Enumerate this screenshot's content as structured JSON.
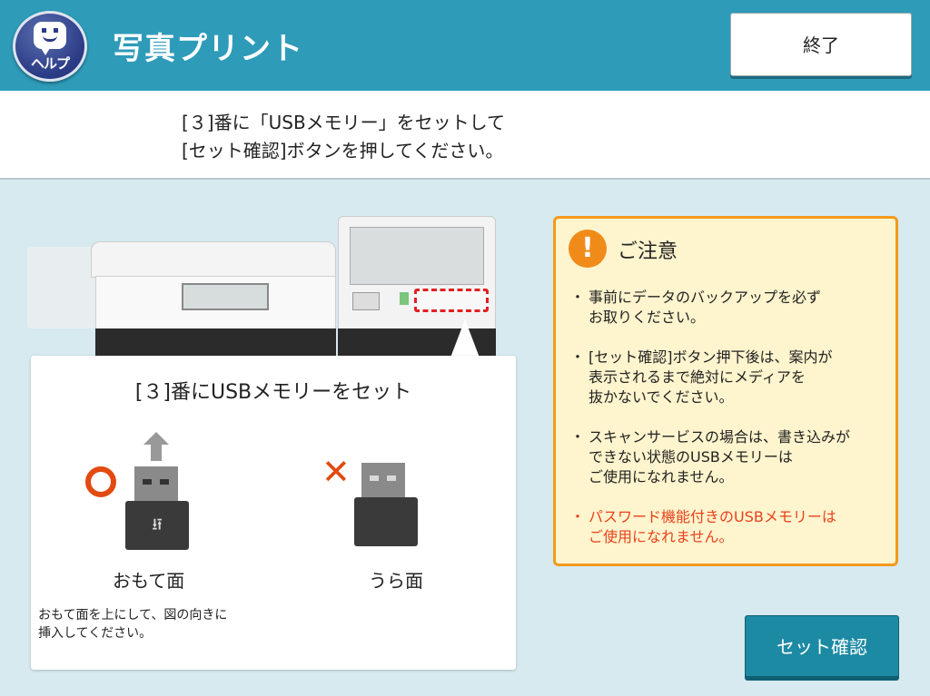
{
  "header": {
    "help_label": "ヘルプ",
    "title": "写真プリント",
    "end_label": "終了"
  },
  "instruction": {
    "line1": "[３]番に「USBメモリー」をセットして",
    "line2": "[セット確認]ボタンを押してください。"
  },
  "guide": {
    "title": "[３]番にUSBメモリーをセット",
    "front_label": "おもて面",
    "back_label": "うら面",
    "ok_mark": "○",
    "ng_mark": "✕",
    "note_line1": "おもて面を上にして、図の向きに",
    "note_line2": "挿入してください。"
  },
  "caution": {
    "icon": "!",
    "title": "ご注意",
    "items": [
      "事前にデータのバックアップを必ず\nお取りください。",
      "[セット確認]ボタン押下後は、案内が\n表示されるまで絶対にメディアを\n抜かないでください。",
      "スキャンサービスの場合は、書き込みが\nできない状態のUSBメモリーは\nご使用になれません。",
      "パスワード機能付きのUSBメモリーは\nご使用になれません。"
    ]
  },
  "confirm_label": "セット確認",
  "colors": {
    "header": "#2e9bb9",
    "background": "#d6eaf0",
    "caution_bg": "#fef4cd",
    "caution_border": "#f39a1c",
    "warning_text": "#e8421c",
    "confirm_button": "#1d8aa3"
  }
}
